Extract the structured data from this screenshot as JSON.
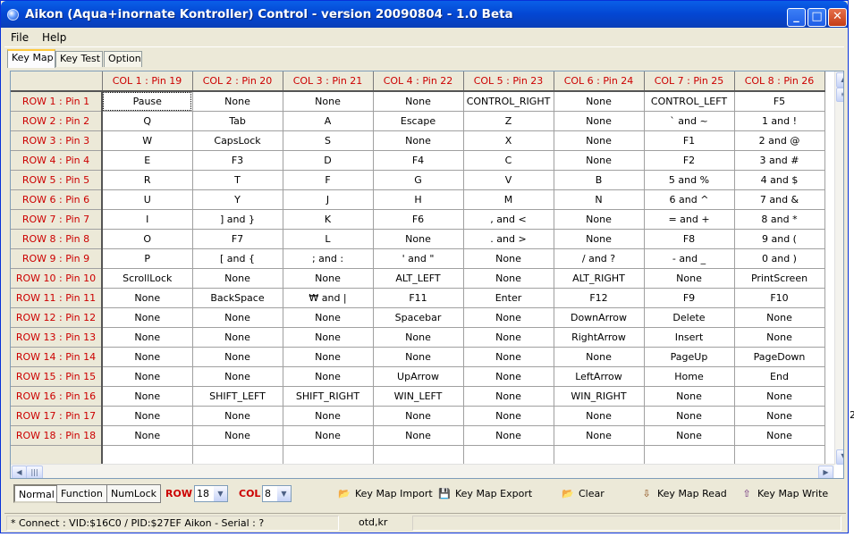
{
  "window": {
    "title": "Aikon (Aqua+inornate Kontroller) Control - version 20090804 - 1.0 Beta"
  },
  "menu": [
    "File",
    "Help"
  ],
  "tabs": [
    "Key Map",
    "Key Test",
    "Option"
  ],
  "grid": {
    "col_headers": [
      "COL 1 : Pin 19",
      "COL 2 : Pin 20",
      "COL 3 : Pin 21",
      "COL 4 : Pin 22",
      "COL 5 : Pin 23",
      "COL 6 : Pin 24",
      "COL 7 : Pin 25",
      "COL 8 : Pin 26"
    ],
    "rows": [
      {
        "label": "ROW 1 : Pin 1",
        "cells": [
          "Pause",
          "None",
          "None",
          "None",
          "CONTROL_RIGHT",
          "None",
          "CONTROL_LEFT",
          "F5"
        ]
      },
      {
        "label": "ROW 2 : Pin 2",
        "cells": [
          "Q",
          "Tab",
          "A",
          "Escape",
          "Z",
          "None",
          "` and ~",
          "1 and !"
        ]
      },
      {
        "label": "ROW 3 : Pin 3",
        "cells": [
          "W",
          "CapsLock",
          "S",
          "None",
          "X",
          "None",
          "F1",
          "2 and @"
        ]
      },
      {
        "label": "ROW 4 : Pin 4",
        "cells": [
          "E",
          "F3",
          "D",
          "F4",
          "C",
          "None",
          "F2",
          "3 and #"
        ]
      },
      {
        "label": "ROW 5 : Pin 5",
        "cells": [
          "R",
          "T",
          "F",
          "G",
          "V",
          "B",
          "5 and %",
          "4 and $"
        ]
      },
      {
        "label": "ROW 6 : Pin 6",
        "cells": [
          "U",
          "Y",
          "J",
          "H",
          "M",
          "N",
          "6 and ^",
          "7 and &"
        ]
      },
      {
        "label": "ROW 7 : Pin 7",
        "cells": [
          "I",
          "] and }",
          "K",
          "F6",
          ", and <",
          "None",
          "= and +",
          "8 and *"
        ]
      },
      {
        "label": "ROW 8 : Pin 8",
        "cells": [
          "O",
          "F7",
          "L",
          "None",
          ". and >",
          "None",
          "F8",
          "9 and ("
        ]
      },
      {
        "label": "ROW 9 : Pin 9",
        "cells": [
          "P",
          "[ and {",
          "; and :",
          "' and \"",
          "None",
          "/ and ?",
          "- and _",
          "0 and )"
        ]
      },
      {
        "label": "ROW 10 : Pin 10",
        "cells": [
          "ScrollLock",
          "None",
          "None",
          "ALT_LEFT",
          "None",
          "ALT_RIGHT",
          "None",
          "PrintScreen"
        ]
      },
      {
        "label": "ROW 11 : Pin 11",
        "cells": [
          "None",
          "BackSpace",
          "₩ and |",
          "F11",
          "Enter",
          "F12",
          "F9",
          "F10"
        ]
      },
      {
        "label": "ROW 12 : Pin 12",
        "cells": [
          "None",
          "None",
          "None",
          "Spacebar",
          "None",
          "DownArrow",
          "Delete",
          "None"
        ]
      },
      {
        "label": "ROW 13 : Pin 13",
        "cells": [
          "None",
          "None",
          "None",
          "None",
          "None",
          "RightArrow",
          "Insert",
          "None"
        ]
      },
      {
        "label": "ROW 14 : Pin 14",
        "cells": [
          "None",
          "None",
          "None",
          "None",
          "None",
          "None",
          "PageUp",
          "PageDown"
        ]
      },
      {
        "label": "ROW 15 : Pin 15",
        "cells": [
          "None",
          "None",
          "None",
          "UpArrow",
          "None",
          "LeftArrow",
          "Home",
          "End"
        ]
      },
      {
        "label": "ROW 16 : Pin 16",
        "cells": [
          "None",
          "SHIFT_LEFT",
          "SHIFT_RIGHT",
          "WIN_LEFT",
          "None",
          "WIN_RIGHT",
          "None",
          "None"
        ]
      },
      {
        "label": "ROW 17 : Pin 17",
        "cells": [
          "None",
          "None",
          "None",
          "None",
          "None",
          "None",
          "None",
          "None"
        ]
      },
      {
        "label": "ROW 18 : Pin 18",
        "cells": [
          "None",
          "None",
          "None",
          "None",
          "None",
          "None",
          "None",
          "None"
        ]
      },
      {
        "label": "",
        "cells": [
          "",
          "",
          "",
          "",
          "",
          "",
          "",
          ""
        ]
      },
      {
        "label": "",
        "cells": [
          "",
          "",
          "",
          "",
          "",
          "",
          "",
          ""
        ]
      }
    ]
  },
  "toolbar": {
    "mode_buttons": [
      "Normal",
      "Function",
      "NumLock"
    ],
    "row_label": "ROW",
    "row_value": "18",
    "col_label": "COL",
    "col_value": "8",
    "actions": [
      {
        "label": "Key Map Import",
        "icon": "folder-open-icon"
      },
      {
        "label": "Key Map Export",
        "icon": "floppy-disk-icon"
      },
      {
        "label": "Clear",
        "icon": "folder-open-icon"
      },
      {
        "label": "Key Map Read",
        "icon": "device-read-icon"
      },
      {
        "label": "Key Map Write",
        "icon": "device-write-icon"
      }
    ]
  },
  "status": {
    "connection": "* Connect : VID:$16C0 / PID:$27EF Aikon - Serial : ?",
    "site": "otd,kr"
  },
  "edge_text": "2",
  "colors": {
    "title_blue": "#0346d2",
    "header_red": "#cc0000",
    "window_bg": "#ece9d8"
  }
}
